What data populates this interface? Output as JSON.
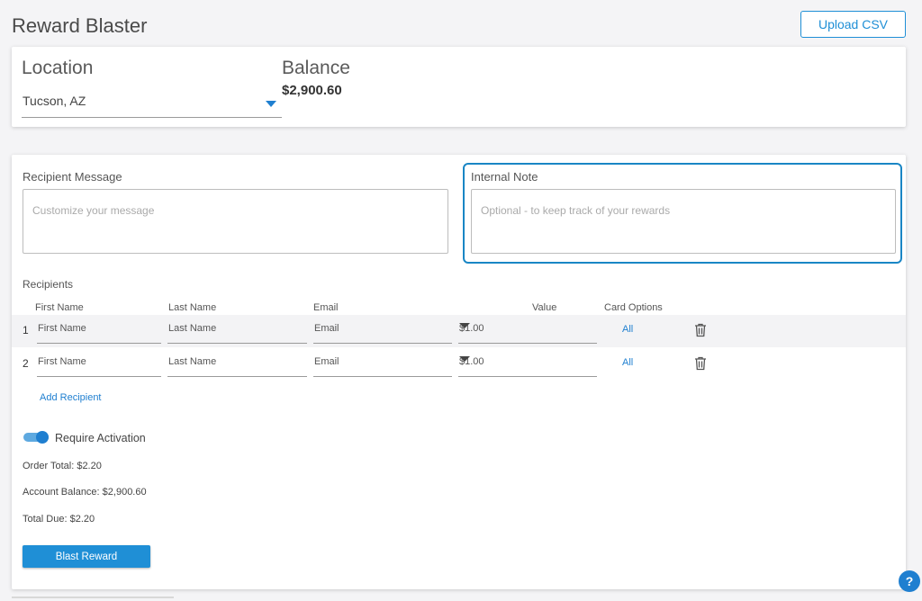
{
  "header": {
    "title": "Reward Blaster",
    "upload_label": "Upload CSV"
  },
  "location": {
    "label": "Location",
    "value": "Tucson, AZ"
  },
  "balance": {
    "label": "Balance",
    "value": "$2,900.60"
  },
  "message": {
    "label": "Recipient Message",
    "placeholder": "Customize your message"
  },
  "note": {
    "label": "Internal Note",
    "placeholder": "Optional - to keep track of your rewards"
  },
  "recipients": {
    "label": "Recipients",
    "columns": {
      "first": "First Name",
      "last": "Last Name",
      "email": "Email",
      "value": "Value",
      "options": "Card Options"
    },
    "rows": [
      {
        "num": "1",
        "first": "First Name",
        "last": "Last Name",
        "email": "Email",
        "value": "$1.00",
        "options": "All"
      },
      {
        "num": "2",
        "first": "First Name",
        "last": "Last Name",
        "email": "Email",
        "value": "$1.00",
        "options": "All"
      }
    ],
    "add_label": "Add Recipient"
  },
  "activation": {
    "label": "Require Activation",
    "enabled": true
  },
  "summary": {
    "order_total": "Order Total: $2.20",
    "account_balance": "Account Balance: $2,900.60",
    "total_due": "Total Due: $2.20"
  },
  "actions": {
    "blast_label": "Blast Reward",
    "help_label": "?"
  },
  "colors": {
    "accent": "#1f8fd6",
    "focus": "#1a86c5",
    "row_shade": "#f3f3f5"
  }
}
